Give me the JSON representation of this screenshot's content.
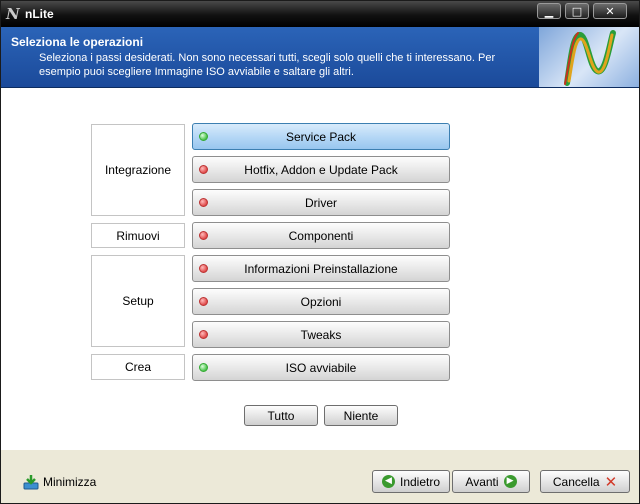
{
  "window": {
    "title": "nLite",
    "logo_glyph": "N",
    "controls": {
      "minimize": "▁",
      "maximize": "□",
      "close": "✕"
    }
  },
  "header": {
    "title": "Seleziona le operazioni",
    "description": "Seleziona i passi desiderati. Non sono necessari tutti, scegli solo quelli che ti interessano. Per esempio puoi scegliere Immagine ISO avviabile e saltare gli altri."
  },
  "groups": [
    {
      "label": "Integrazione"
    },
    {
      "label": "Rimuovi"
    },
    {
      "label": "Setup"
    },
    {
      "label": "Crea"
    }
  ],
  "options": [
    {
      "label": "Service Pack",
      "status": "green",
      "active": true
    },
    {
      "label": "Hotfix, Addon e Update Pack",
      "status": "red"
    },
    {
      "label": "Driver",
      "status": "red"
    },
    {
      "label": "Componenti",
      "status": "red"
    },
    {
      "label": "Informazioni Preinstallazione",
      "status": "red"
    },
    {
      "label": "Opzioni",
      "status": "red"
    },
    {
      "label": "Tweaks",
      "status": "red"
    },
    {
      "label": "ISO avviabile",
      "status": "green"
    }
  ],
  "select_buttons": {
    "all": "Tutto",
    "none": "Niente"
  },
  "footer": {
    "minimize_label": "Minimizza",
    "back_label": "Indietro",
    "next_label": "Avanti",
    "cancel_label": "Cancella"
  },
  "colors": {
    "header_bg": "#2b64b8",
    "active_option": "#b6d8f6",
    "led_green": "#4bc24b",
    "led_red": "#e04b4b"
  }
}
